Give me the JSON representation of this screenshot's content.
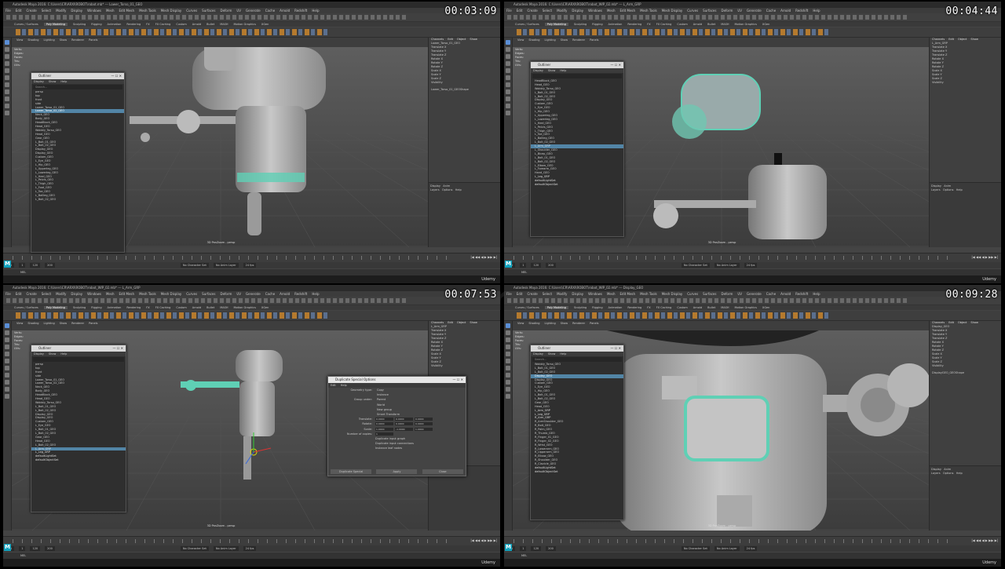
{
  "window_title_prefix": "Autodesk Maya 2016",
  "watermark": "www.cg-persia.com",
  "menus": [
    "File",
    "Edit",
    "Create",
    "Select",
    "Modify",
    "Display",
    "Windows",
    "Mesh",
    "Edit Mesh",
    "Mesh Tools",
    "Mesh Display",
    "Curves",
    "Surfaces",
    "Deform",
    "UV",
    "Generate",
    "Cache",
    "Arnold",
    "Redshift",
    "Help"
  ],
  "shelf_tabs": [
    "Curves / Surfaces",
    "Poly Modeling",
    "Sculpting",
    "Rigging",
    "Animation",
    "Rendering",
    "FX",
    "FX Caching",
    "Custom",
    "Arnold",
    "Bullet",
    "MASH",
    "Motion Graphics",
    "XGen"
  ],
  "panel_menus": [
    "View",
    "Shading",
    "Lighting",
    "Show",
    "Renderer",
    "Panels"
  ],
  "hud": {
    "rows": [
      [
        "Verts:",
        "Edges:",
        "Faces:",
        "Tris:",
        "UVs:"
      ]
    ]
  },
  "channel_box_tabs": [
    "Channels",
    "Edit",
    "Object",
    "Show"
  ],
  "channel_attrs": [
    "Translate X",
    "Translate Y",
    "Translate Z",
    "Rotate X",
    "Rotate Y",
    "Rotate Z",
    "Scale X",
    "Scale Y",
    "Scale Z",
    "Visibility"
  ],
  "viewport_label": "3D PanZoom - persp",
  "helpline_brand": "Udemy",
  "range": {
    "start": "1",
    "end": "120",
    "anim_end": "200",
    "character": "No Character Set",
    "anim_layer": "No Anim Layer",
    "fps": "24 fps"
  },
  "quads": [
    {
      "timecode": "00:03:09",
      "title": "Autodesk Maya 2016: C:\\Users\\CR\\ARXI\\ROBOT\\robot.mb* --- Lower_Torso_01_GEO",
      "selected_node": "Lower_Torso_01_GEO",
      "shape": "Lower_Torso_01_GEOShape",
      "outliner": {
        "title": "Outliner",
        "menus": [
          "Display",
          "Show",
          "Help"
        ],
        "search": "Search...",
        "items": [
          "persp",
          "top",
          "front",
          "side",
          "Lower_Torso_01_GEO",
          "Lower_Torso_02_GEO",
          "Neck_GEO",
          "Body_GEO",
          "HeadBlock_GEO",
          "Head_GEO",
          "Wobbly_Torso_GEO",
          "Head_GEO",
          "Gear_GEO",
          "L_Bolt_01_GEO",
          "L_Bolt_02_GEO",
          "Display_GEO",
          "Display_GEO",
          "Custom_GEO",
          "L_Eye_GEO",
          "L_Hip_GEO",
          "L_Upperleg_GEO",
          "L_Lowerleg_GEO",
          "L_Heel_GEO",
          "L_Pelvis_GEO",
          "L_Thigh_GEO",
          "L_Foot_GEO",
          "L_Toe_GEO",
          "L_Ballleg_GEO",
          "L_Bolt_02_GEO"
        ],
        "selected_index": 5
      }
    },
    {
      "timecode": "00:04:44",
      "title": "Autodesk Maya 2016: C:\\Users\\CR\\ARXI\\ROBOT\\robot_WIP_02.mb* --- L_Arm_GRP",
      "selected_node": "L_Arm_GRP",
      "outliner": {
        "title": "Outliner",
        "menus": [
          "Display",
          "Show",
          "Help"
        ],
        "search": "",
        "items": [
          "HeadBlock_GEO",
          "Head_GEO",
          "Wobbly_Torso_GEO",
          "L_Bolt_01_GEO",
          "L_Bolt_02_GEO",
          "Display_GEO",
          "Custom_GEO",
          "L_Eye_GEO",
          "L_Hip_GEO",
          "L_Upperleg_GEO",
          "L_Lowerleg_GEO",
          "L_Heel_GEO",
          "L_Pelvis_GEO",
          "L_Thigh_GEO",
          "L_Toe_GEO",
          "L_Ballleg_GEO",
          "L_Bolt_02_GEO",
          "L_Arm_GRP",
          "L_Shoulder_GEO",
          "L_Bicep_GEO",
          "L_Bolt_01_GEO",
          "L_Bolt_02_GEO",
          "L_Elbow_GEO",
          "L_Forearm_GEO",
          "Hand_GEO",
          "L_Leg_GRP",
          "defaultLightSet",
          "defaultObjectSet"
        ],
        "selected_index": 17
      }
    },
    {
      "timecode": "00:07:53",
      "title": "Autodesk Maya 2016: C:\\Users\\CR\\ARXI\\ROBOT\\robot_WIP_02.mb* --- L_Arm_GRP",
      "selected_node": "L_Arm_GRP",
      "outliner": {
        "title": "Outliner",
        "menus": [
          "Display",
          "Show",
          "Help"
        ],
        "search": "",
        "items": [
          "persp",
          "top",
          "front",
          "side",
          "Lower_Torso_01_GEO",
          "Lower_Torso_02_GEO",
          "Neck_GEO",
          "Body_GEO",
          "HeadBlock_GEO",
          "Head_GEO",
          "Wobbly_Torso_GEO",
          "L_Bolt_01_GEO",
          "L_Bolt_02_GEO",
          "Display_GEO",
          "Display_GEO",
          "Custom_GEO",
          "L_Eye_GEO",
          "L_Bolt_01_GEO",
          "L_Bolt_02_GEO",
          "Gear_GEO",
          "Head_GEO",
          "L_Bolt_02_GEO",
          "L_Arm_GRP",
          "L_Leg_GRP",
          "defaultLightSet",
          "defaultObjectSet"
        ],
        "selected_index": 22
      },
      "dup_dialog": {
        "title": "Duplicate Special Options",
        "menus": [
          "Edit",
          "Help"
        ],
        "geometry_type_label": "Geometry type:",
        "geometry_type": "Copy",
        "geometry_type_alt": "Instance",
        "group_under_label": "Group under:",
        "group_under": [
          "Parent",
          "World",
          "New group"
        ],
        "smart_transform": "Smart Transform",
        "translate_label": "Translate:",
        "translate": [
          "0.0000",
          "0.0000",
          "0.0000"
        ],
        "rotate_label": "Rotate:",
        "rotate": [
          "0.0000",
          "0.0000",
          "0.0000"
        ],
        "scale_label": "Scale:",
        "scale": [
          "1.0000",
          "-1.0000",
          "1.0000"
        ],
        "copies_label": "Number of copies:",
        "copies": "1",
        "checks": [
          "Duplicate input graph",
          "Duplicate input connections",
          "Instance leaf nodes"
        ],
        "buttons": [
          "Duplicate Special",
          "Apply",
          "Close"
        ]
      }
    },
    {
      "timecode": "00:09:28",
      "title": "Autodesk Maya 2016: C:\\Users\\CR\\ARXI\\ROBOT\\robot_WIP_02.mb* --- Display_GEO",
      "selected_node": "Display_GEO",
      "shape": "DisplayGEO_GEOShape",
      "outliner": {
        "title": "Outliner",
        "menus": [
          "Display",
          "Show",
          "Help"
        ],
        "search": "Search...",
        "items": [
          "Wobbly_Torso_GEO",
          "L_Bolt_01_GEO",
          "L_Bolt_02_GEO",
          "Display_GEO",
          "Display_GEO",
          "Custom_GEO",
          "L_Eye_GEO",
          "L_Hip_GEO",
          "L_Bolt_01_GEO",
          "L_Bolt_02_GEO",
          "Gear_GEO",
          "Head_GEO",
          "L_Arm_GRP",
          "L_Leg_GRP",
          "R_Arm_GRP",
          "R_ArmShoulder_GEO",
          "R_Bolt_GEO",
          "R_Palm_GEO",
          "R_Thumb_GEO",
          "R_Finger_01_GEO",
          "R_Finger_02_GEO",
          "R_Wrist_GEO",
          "R_Lowerarm_GEO",
          "R_Upperarm_GEO",
          "R_Elbow_GEO",
          "R_Shoulder_GEO",
          "R_Clavicle_GEO",
          "defaultLightSet",
          "defaultObjectSet"
        ],
        "selected_index": 3
      }
    }
  ]
}
